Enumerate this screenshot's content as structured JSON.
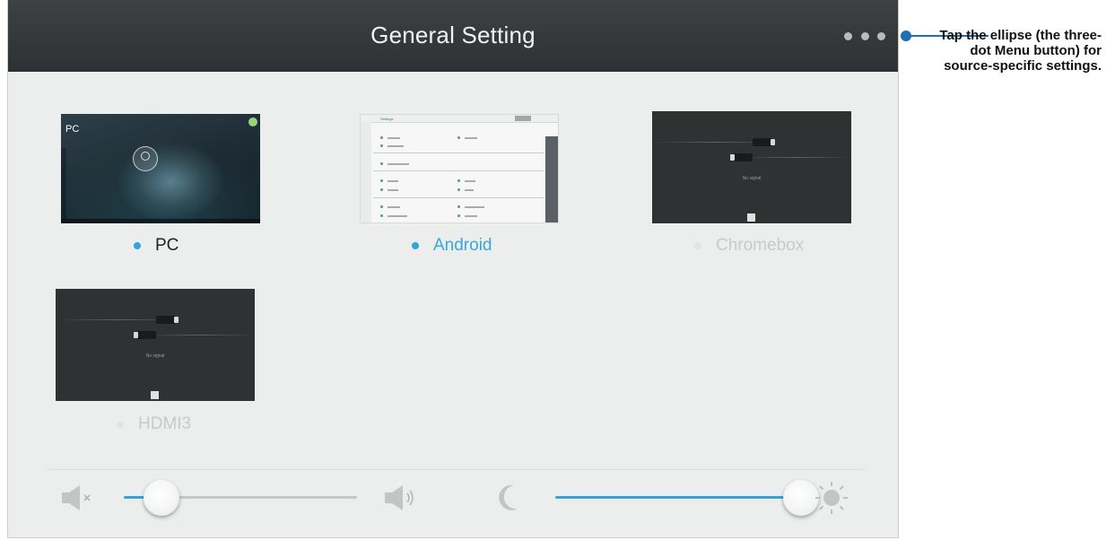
{
  "header": {
    "title": "General Setting",
    "menu_icon": "more-horizontal-icon"
  },
  "sources": [
    {
      "label": "PC",
      "status": "connected",
      "color": "#33a3dc",
      "text_color": "#222222"
    },
    {
      "label": "Android",
      "status": "selected",
      "color": "#33a3dc",
      "text_color": "#36a8de"
    },
    {
      "label": "Chromebox",
      "status": "no-signal",
      "color": "#e2e3e3",
      "text_color": "#c9cacb"
    },
    {
      "label": "HDMI3",
      "status": "no-signal",
      "color": "#e2e3e3",
      "text_color": "#c9cacb"
    }
  ],
  "thumbnails": {
    "pc": {
      "title": "PC"
    },
    "no_signal_text": "No signal"
  },
  "controls": {
    "volume": {
      "level": 0.16,
      "icons": [
        "volume-mute-icon",
        "volume-up-icon"
      ]
    },
    "brightness": {
      "level": 0.98,
      "icons": [
        "moon-icon",
        "sun-icon"
      ]
    },
    "accent": "#33a3dc",
    "track_inactive": "#c5c7c9"
  },
  "callout": {
    "text": "Tap the ellipse (the three-dot Menu button) for source-specific settings.",
    "color": "#1f6fb4"
  }
}
